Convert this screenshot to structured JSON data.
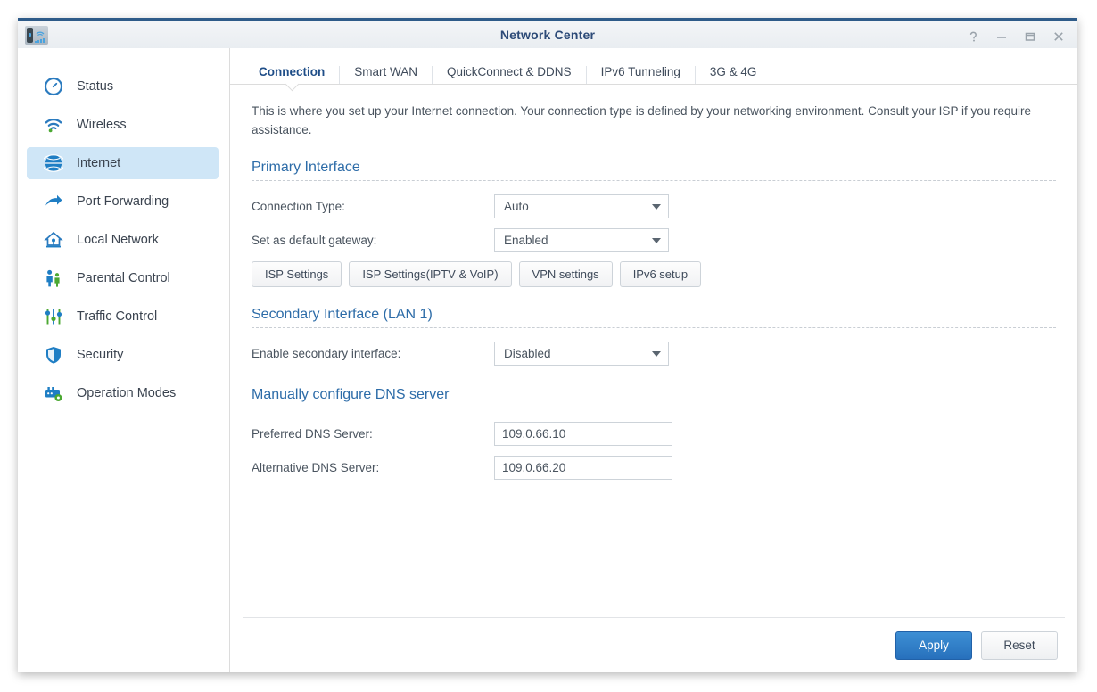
{
  "window": {
    "title": "Network Center",
    "app_icon": "router-wifi-icon",
    "controls": [
      {
        "name": "help-button",
        "glyph": "?"
      },
      {
        "name": "minimize-button",
        "glyph": "–"
      },
      {
        "name": "maximize-button",
        "glyph": "☐"
      },
      {
        "name": "close-button",
        "glyph": "✕"
      }
    ]
  },
  "sidebar": {
    "items": [
      {
        "label": "Status",
        "icon": "gauge-icon",
        "active": false
      },
      {
        "label": "Wireless",
        "icon": "wifi-icon",
        "active": false
      },
      {
        "label": "Internet",
        "icon": "globe-icon",
        "active": true
      },
      {
        "label": "Port Forwarding",
        "icon": "arrow-forward-icon",
        "active": false
      },
      {
        "label": "Local Network",
        "icon": "house-icon",
        "active": false
      },
      {
        "label": "Parental Control",
        "icon": "parents-child-icon",
        "active": false
      },
      {
        "label": "Traffic Control",
        "icon": "sliders-icon",
        "active": false
      },
      {
        "label": "Security",
        "icon": "shield-icon",
        "active": false
      },
      {
        "label": "Operation Modes",
        "icon": "modes-gear-icon",
        "active": false
      }
    ]
  },
  "tabs": [
    {
      "label": "Connection",
      "active": true
    },
    {
      "label": "Smart WAN",
      "active": false
    },
    {
      "label": "QuickConnect & DDNS",
      "active": false
    },
    {
      "label": "IPv6 Tunneling",
      "active": false
    },
    {
      "label": "3G & 4G",
      "active": false
    }
  ],
  "main": {
    "intro": "This is where you set up your Internet connection. Your connection type is defined by your networking environment. Consult your ISP if you require assistance.",
    "primary_interface": {
      "title": "Primary Interface",
      "connection_type_label": "Connection Type:",
      "connection_type_value": "Auto",
      "default_gateway_label": "Set as default gateway:",
      "default_gateway_value": "Enabled",
      "buttons": [
        "ISP Settings",
        "ISP Settings(IPTV & VoIP)",
        "VPN settings",
        "IPv6 setup"
      ]
    },
    "secondary_interface": {
      "title": "Secondary Interface (LAN 1)",
      "enable_label": "Enable secondary interface:",
      "enable_value": "Disabled"
    },
    "dns": {
      "title": "Manually configure DNS server",
      "preferred_label": "Preferred DNS Server:",
      "preferred_value": "109.0.66.10",
      "alternative_label": "Alternative DNS Server:",
      "alternative_value": "109.0.66.20"
    }
  },
  "footer": {
    "apply_label": "Apply",
    "reset_label": "Reset"
  },
  "colors": {
    "accent_blue": "#2d6ca8",
    "title_blue": "#2c4a77",
    "active_nav_bg": "#cfe6f7",
    "primary_button": "#2770bc"
  }
}
